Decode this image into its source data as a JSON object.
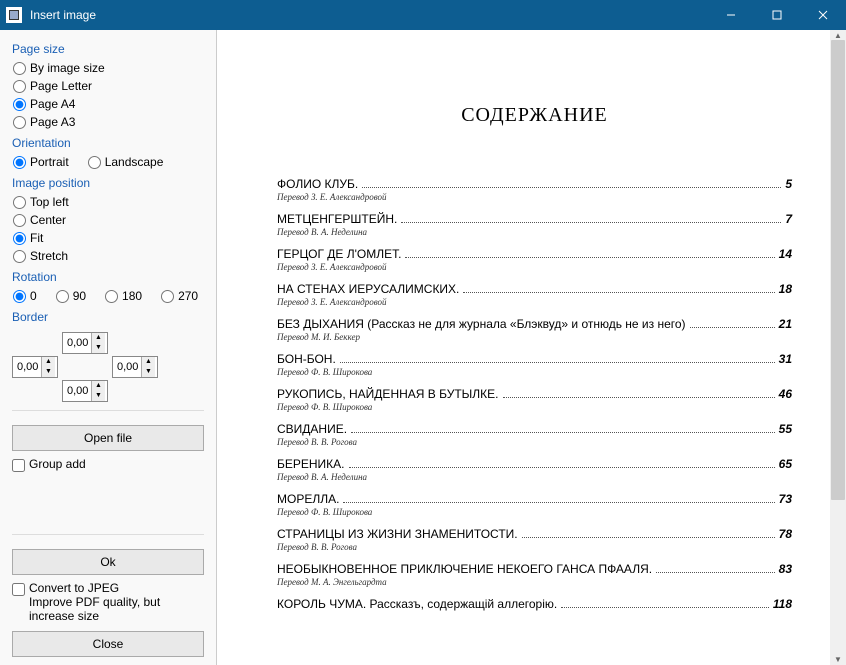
{
  "window": {
    "title": "Insert image"
  },
  "pageSize": {
    "label": "Page size",
    "options": {
      "byImage": "By image size",
      "letter": "Page Letter",
      "a4": "Page A4",
      "a3": "Page A3"
    }
  },
  "orientation": {
    "label": "Orientation",
    "portrait": "Portrait",
    "landscape": "Landscape"
  },
  "imagePosition": {
    "label": "Image position",
    "topLeft": "Top left",
    "center": "Center",
    "fit": "Fit",
    "stretch": "Stretch"
  },
  "rotation": {
    "label": "Rotation",
    "r0": "0",
    "r90": "90",
    "r180": "180",
    "r270": "270"
  },
  "border": {
    "label": "Border",
    "top": "0,00",
    "left": "0,00",
    "right": "0,00",
    "bottom": "0,00"
  },
  "buttons": {
    "openFile": "Open file",
    "ok": "Ok",
    "close": "Close"
  },
  "checkboxes": {
    "groupAdd": "Group add",
    "convertJpeg": "Convert to JPEG",
    "convertJpegHint": "Improve PDF quality, but increase size"
  },
  "doc": {
    "heading": "СОДЕРЖАНИЕ",
    "entries": [
      {
        "title": "ФОЛИО КЛУБ.",
        "trans": "Перевод З. Е. Александровой",
        "page": "5"
      },
      {
        "title": "МЕТЦЕНГЕРШТЕЙН.",
        "trans": "Перевод В. А. Неделина",
        "page": "7"
      },
      {
        "title": "ГЕРЦОГ ДЕ Л'ОМЛЕТ.",
        "trans": "Перевод З. Е. Александровой",
        "page": "14"
      },
      {
        "title": "НА СТЕНАХ ИЕРУСАЛИМСКИХ.",
        "trans": "Перевод З. Е. Александровой",
        "page": "18"
      },
      {
        "title": "БЕЗ ДЫХАНИЯ (Рассказ не для журнала «Блэквуд» и отнюдь не из него)",
        "trans": "Перевод М. И. Беккер",
        "page": "21"
      },
      {
        "title": "БОН-БОН.",
        "trans": "Перевод Ф. В. Широкова",
        "page": "31"
      },
      {
        "title": "РУКОПИСЬ, НАЙДЕННАЯ В БУТЫЛКЕ.",
        "trans": "Перевод Ф. В. Широкова",
        "page": "46"
      },
      {
        "title": "СВИДАНИЕ.",
        "trans": "Перевод В. В. Рогова",
        "page": "55"
      },
      {
        "title": "БЕРЕНИКА.",
        "trans": "Перевод В. А. Неделина",
        "page": "65"
      },
      {
        "title": "МОРЕЛЛА.",
        "trans": "Перевод Ф. В. Широкова",
        "page": "73"
      },
      {
        "title": "СТРАНИЦЫ ИЗ ЖИЗНИ ЗНАМЕНИТОСТИ.",
        "trans": "Перевод В. В. Рогова",
        "page": "78"
      },
      {
        "title": "НЕОБЫКНОВЕННОЕ ПРИКЛЮЧЕНИЕ НЕКОЕГО ГАНСА ПФААЛЯ.",
        "trans": "Перевод М. А. Энгельгардта",
        "page": "83"
      },
      {
        "title": "КОРОЛЬ ЧУМА. Рассказъ, содержащiй аллегорiю.",
        "trans": "",
        "page": "118"
      }
    ]
  }
}
